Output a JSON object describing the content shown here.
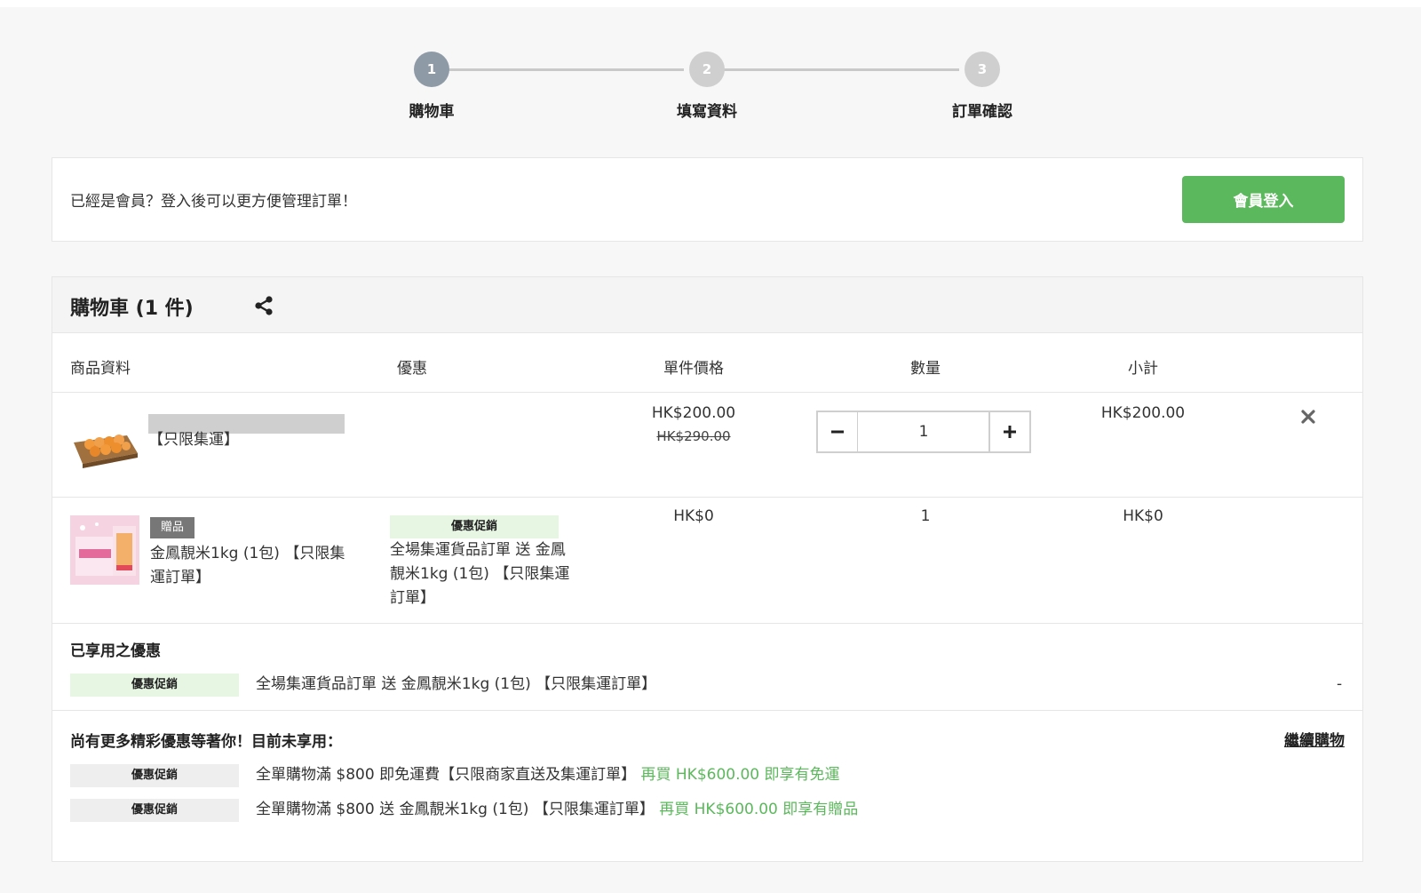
{
  "steps": [
    {
      "number": "1",
      "label": "購物車"
    },
    {
      "number": "2",
      "label": "填寫資料"
    },
    {
      "number": "3",
      "label": "訂單確認"
    }
  ],
  "login": {
    "prompt": "已經是會員？登入後可以更方便管理訂單！",
    "button_label": "會員登入"
  },
  "cart": {
    "title": "購物車 (1 件)",
    "columns": [
      "商品資料",
      "優惠",
      "單件價格",
      "數量",
      "小計"
    ],
    "items": [
      {
        "name_suffix": "【只限集運】",
        "price": "HK$200.00",
        "original_price": "HK$290.00",
        "quantity": "1",
        "subtotal": "HK$200.00"
      },
      {
        "badge": "贈品",
        "name": "金鳳靚米1kg (1包) 【只限集運訂單】",
        "promo_tag": "優惠促銷",
        "promo_text": "全場集運貨品訂單 送 金鳳靚米1kg (1包) 【只限集運訂單】",
        "price": "HK$0",
        "quantity": "1",
        "subtotal": "HK$0"
      }
    ],
    "applied": {
      "title": "已享用之優惠",
      "tag": "優惠促銷",
      "text": "全場集運貨品訂單 送 金鳳靚米1kg (1包) 【只限集運訂單】",
      "value": "-"
    },
    "more": {
      "title": "尚有更多精彩優惠等著你！目前未享用：",
      "continue_label": "繼續購物",
      "offers": [
        {
          "tag": "優惠促銷",
          "text": "全單購物滿 $800 即免運費【只限商家直送及集運訂單】",
          "hint": "再買 HK$600.00 即享有免運"
        },
        {
          "tag": "優惠促銷",
          "text": "全單購物滿 $800 送 金鳳靚米1kg (1包) 【只限集運訂單】",
          "hint": "再買 HK$600.00 即享有贈品"
        }
      ]
    }
  },
  "colors": {
    "accent_green": "#5cb85c",
    "promo_green_bg": "#e6f6e3",
    "step_active": "#8e9aa6",
    "step_inactive": "#cfcfcf"
  },
  "icons": [
    "share-icon",
    "minus-icon",
    "plus-icon",
    "close-icon"
  ]
}
